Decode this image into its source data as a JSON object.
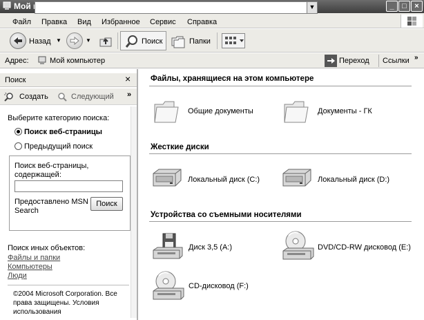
{
  "window": {
    "title": "Мой компьютер"
  },
  "menu": [
    "Файл",
    "Правка",
    "Вид",
    "Избранное",
    "Сервис",
    "Справка"
  ],
  "toolbar": {
    "back": "Назад",
    "search": "Поиск",
    "folders": "Папки"
  },
  "address": {
    "label": "Адрес:",
    "value": "Мой компьютер",
    "go": "Переход",
    "links": "Ссылки"
  },
  "search_pane": {
    "title": "Поиск",
    "new": "Создать",
    "next": "Следующий",
    "prompt": "Выберите категорию поиска:",
    "option1": "Поиск веб-страницы",
    "option2": "Предыдущий поиск",
    "box_label_1": "Поиск веб-страницы,",
    "box_label_2": "содержащей:",
    "input_value": "",
    "provided_1": "Предоставлено MSN",
    "provided_2": "Search",
    "go_button": "Поиск",
    "other_title": "Поиск иных объектов:",
    "link_files": "Файлы и папки",
    "link_computers": "Компьютеры",
    "link_people": "Люди",
    "copyright_1": "©2004 Microsoft Corporation. Все",
    "copyright_2": "права защищены.     Условия",
    "copyright_3": "использования"
  },
  "groups": {
    "files": {
      "title": "Файлы, хранящиеся на этом компьютере",
      "items": [
        "Общие документы",
        "Документы - ГК"
      ]
    },
    "drives": {
      "title": "Жесткие диски",
      "items": [
        "Локальный диск (C:)",
        "Локальный диск (D:)"
      ]
    },
    "removable": {
      "title": "Устройства со съемными носителями",
      "items": [
        "Диск 3,5 (A:)",
        "DVD/CD-RW дисковод (E:)",
        "CD-дисковод (F:)"
      ]
    }
  }
}
